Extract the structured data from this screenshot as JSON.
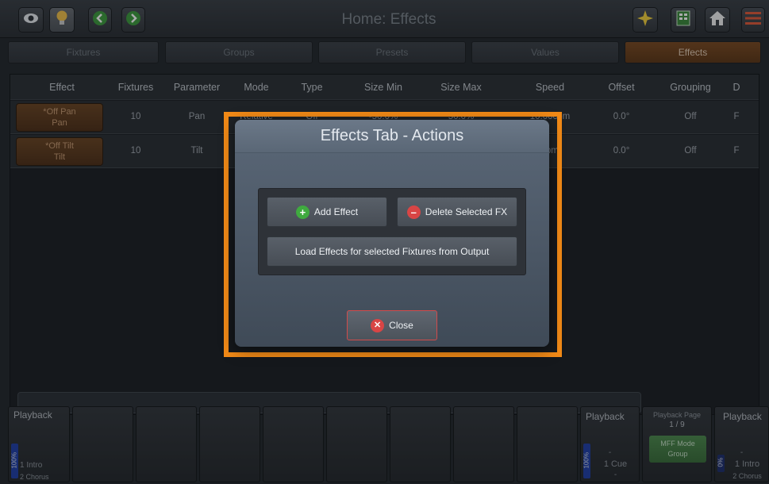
{
  "header": {
    "title": "Home: Effects",
    "icons": [
      "eye-icon",
      "lightbulb-icon",
      "arrow-left-icon",
      "arrow-right-icon",
      "sparkle-icon",
      "layout-icon",
      "home-icon",
      "menu-icon"
    ]
  },
  "tabs": [
    {
      "label": "Fixtures",
      "active": false
    },
    {
      "label": "Groups",
      "active": false
    },
    {
      "label": "Presets",
      "active": false
    },
    {
      "label": "Values",
      "active": false
    },
    {
      "label": "Effects",
      "active": true
    }
  ],
  "table": {
    "columns": [
      "Effect",
      "Fixtures",
      "Parameter",
      "Mode",
      "Type",
      "Size Min",
      "Size Max",
      "Speed",
      "Offset",
      "Grouping",
      "D"
    ],
    "rows": [
      {
        "effect_line1": "*Off Pan",
        "effect_line2": "Pan",
        "fixtures": "10",
        "parameter": "Pan",
        "mode": "Relative",
        "type": "Off",
        "size_min": "-50.0%",
        "size_max": "50.0%",
        "speed": "10.00cpm",
        "offset": "0.0°",
        "grouping": "Off",
        "d": "F"
      },
      {
        "effect_line1": "*Off Tilt",
        "effect_line2": "Tilt",
        "fixtures": "10",
        "parameter": "Tilt",
        "mode": "",
        "type": "",
        "size_min": "",
        "size_max": "",
        "speed": "cpm",
        "offset": "0.0°",
        "grouping": "Off",
        "d": "F"
      }
    ]
  },
  "dialog": {
    "title": "Effects Tab - Actions",
    "add_effect": "Add Effect",
    "delete_selected": "Delete Selected FX",
    "load_effects": "Load Effects for selected Fixtures from Output",
    "close": "Close"
  },
  "playbacks": {
    "left": {
      "title": "Playback",
      "cue": "1 Intro",
      "next": "2 Chorus",
      "level": "100%"
    },
    "right1": {
      "title": "Playback",
      "dash_top": "-",
      "cue": "1 Cue",
      "dash_bottom": "-",
      "level": "100%"
    },
    "page": {
      "title": "Playback Page",
      "value": "1 / 9",
      "mode_label": "MFF Mode",
      "mode_value": "Group"
    },
    "right2": {
      "title": "Playback",
      "dash_top": "-",
      "cue": "1 Intro",
      "next": "2 Chorus",
      "level": "0%"
    }
  },
  "colors": {
    "accent_orange": "#f28a17",
    "effects_tab": "#7b4a22",
    "add_green": "#3faa3f",
    "delete_red": "#d84545"
  }
}
